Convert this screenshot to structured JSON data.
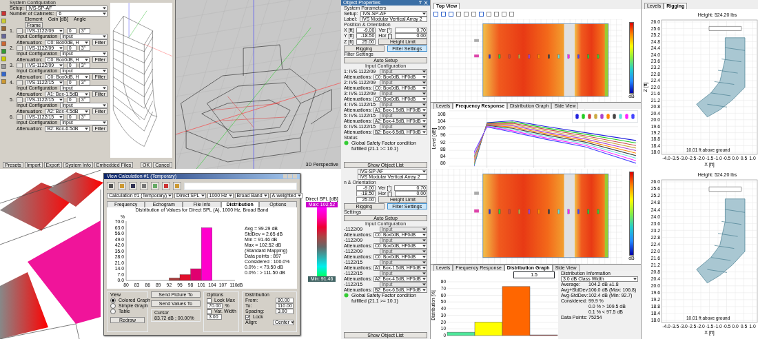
{
  "config_dialog": {
    "title": "System Configuration",
    "setup_label": "Setup:",
    "setup": "IVS-SP-AF",
    "cabinets_label": "Number of Cabinets:",
    "cabinets": "6",
    "headers": [
      "Element",
      "Gain [dB]",
      "Angle"
    ],
    "frame": "Frame",
    "elements": [
      {
        "num": "1.",
        "model": "IVS-1122/09",
        "gain": "0",
        "angle": "3°",
        "input_label": "Input Configuration",
        "input": "Input",
        "atten_label": "Attenuation:",
        "atten": "C0: Box0dB, H",
        "filter": "Filter"
      },
      {
        "num": "2.",
        "model": "IVS-1122/09",
        "gain": "0",
        "angle": "3°",
        "input_label": "Input Configuration",
        "input": "Input",
        "atten_label": "Attenuation:",
        "atten": "C0: Box0dB, H",
        "filter": "Filter"
      },
      {
        "num": "3.",
        "model": "IVS-1122/09",
        "gain": "0",
        "angle": "3°",
        "input_label": "Input Configuration",
        "input": "Input",
        "atten_label": "Attenuation:",
        "atten": "C0: Box0dB, H",
        "filter": "Filter"
      },
      {
        "num": "4.",
        "model": "IVS-1122/15",
        "gain": "0",
        "angle": "3°",
        "input_label": "Input Configuration",
        "input": "Input",
        "atten_label": "Attenuation:",
        "atten": "A1: Box-1.5dB",
        "filter": "Filter"
      },
      {
        "num": "5.",
        "model": "IVS-1122/15",
        "gain": "0",
        "angle": "3°",
        "input_label": "Input Configuration",
        "input": "Input",
        "atten_label": "Attenuation:",
        "atten": "A2: Box-4.5dB",
        "filter": "Filter"
      },
      {
        "num": "6.",
        "model": "IVS-1122/15",
        "gain": "0",
        "angle": "3°",
        "input_label": "Input Configuration",
        "input": "Input",
        "atten_label": "Attenuation:",
        "atten": "B2: Box-6.5dB",
        "filter": "Filter"
      }
    ],
    "buttons": [
      "Presets",
      "Import",
      "Export",
      "System Info",
      "Embedded Files"
    ],
    "dialog_buttons": [
      "OK",
      "Cancel"
    ]
  },
  "view_3d": {
    "label": "3D Perspective"
  },
  "props_top": {
    "title": "Object Properties",
    "section1": "System Parameters",
    "setup_label": "Setup:",
    "setup": "IVS-SP-AF",
    "label_label": "Label:",
    "label": "IVS Modular Vertical Array 2",
    "section2": "Position & Orientation",
    "coords": [
      {
        "label": "X [ft]",
        "value": "-9.00",
        "angle_label": "Ver [°]",
        "angle": "0.70"
      },
      {
        "label": "Y [ft]",
        "value": "-18.50",
        "angle_label": "Hor [°]",
        "angle": "0.00"
      },
      {
        "label": "Z [ft]",
        "value": "25.00"
      }
    ],
    "height_limit": "Height Limit",
    "tabs": [
      {
        "label": "Rigging",
        "selected": false
      },
      {
        "label": "Filter Settings",
        "selected": true
      }
    ],
    "section3": "Filter Settings",
    "auto_setup": "Auto Setup",
    "input_config": "Input Configuration",
    "filters": [
      {
        "label": "1: IVS-1122/09",
        "input": "Input",
        "atten_label": "Attenuations:",
        "atten": "C0: Box0dB, HF0dB"
      },
      {
        "label": "2: IVS-1122/09",
        "input": "Input",
        "atten_label": "Attenuations:",
        "atten": "C0: Box0dB, HF0dB"
      },
      {
        "label": "3: IVS-1122/09",
        "input": "Input",
        "atten_label": "Attenuations:",
        "atten": "C0: Box0dB, HF0dB"
      },
      {
        "label": "4: IVS-1122/15",
        "input": "Input",
        "atten_label": "Attenuations:",
        "atten": "A1: Box-1.5dB, HF0dB"
      },
      {
        "label": "5: IVS-1122/15",
        "input": "Input",
        "atten_label": "Attenuations:",
        "atten": "A2: Box-4.5dB, HF0dB"
      },
      {
        "label": "6: IVS-1122/15",
        "input": "Input",
        "atten_label": "Attenuations:",
        "atten": "B2: Box-6.5dB, HF0dB"
      }
    ],
    "status_label": "Status",
    "status": "Global Safety Factor condition fulfilled (21.1 >= 10.1)",
    "show_list": "Show Object List"
  },
  "props_bottom": {
    "setup": "IVS-SP-AF",
    "label": "IVS Modular Vertical Array 2",
    "section2": "n & Orientation",
    "coords": [
      {
        "value": "-9.00",
        "angle_label": "Ver [°]",
        "angle": "0.70"
      },
      {
        "value": "-18.50",
        "angle_label": "Hor [°]",
        "angle": "0.00"
      },
      {
        "value": "25.00"
      }
    ],
    "height_limit": "Height Limit",
    "tabs": [
      {
        "label": "Rigging",
        "selected": false
      },
      {
        "label": "Filter Settings",
        "selected": true
      }
    ],
    "section3": "Settings",
    "auto_setup": "Auto Setup",
    "input_config": "Input Configuration",
    "filters": [
      {
        "label": "-1122/09",
        "input": "Input",
        "atten_label": "Attenuations:",
        "atten": "C0: Box0dB, HF0dB"
      },
      {
        "label": "-1122/09",
        "input": "Input",
        "atten_label": "Attenuations:",
        "atten": "C0: Box0dB, HF0dB"
      },
      {
        "label": "-1122/09",
        "input": "Input",
        "atten_label": "Attenuations:",
        "atten": "C0: Box0dB, HF0dB"
      },
      {
        "label": "-1122/15",
        "input": "Input",
        "atten_label": "Attenuations:",
        "atten": "A1: Box-1.5dB, HF0dB"
      },
      {
        "label": "-1122/15",
        "input": "Input",
        "atten_label": "Attenuations:",
        "atten": "A2: Box-4.5dB, HF0dB"
      },
      {
        "label": "-1122/15",
        "input": "Input",
        "atten_label": "Attenuations:",
        "atten": "B2: Box-6.5dB, HF0dB"
      }
    ],
    "status": "Global Safety Factor condition fulfilled (21.1 >= 10.1)",
    "show_list": "Show Object List"
  },
  "top_view": {
    "tab": "Top View",
    "unit": "dB"
  },
  "rigging": {
    "tabs": [
      {
        "label": "Levels",
        "selected": false
      },
      {
        "label": "Rigging",
        "selected": true
      }
    ],
    "title": "Height: 524.20 lbs",
    "yticks": [
      "26.0",
      "25.6",
      "25.2",
      "24.8",
      "24.4",
      "24.0",
      "23.6",
      "23.2",
      "22.8",
      "22.4",
      "22.0",
      "21.6",
      "21.2",
      "20.8",
      "20.4",
      "20.0",
      "19.6",
      "19.2",
      "18.8",
      "18.4",
      "18.0"
    ],
    "xticks": [
      "-4.0",
      "-3.5",
      "-3.0",
      "-2.5",
      "-2.0",
      "-1.5",
      "-1.0",
      "-0.5",
      "0.0",
      "0.5",
      "1.0"
    ],
    "xlabel": "X [ft]",
    "ylabel": "Z [ft]",
    "note": "10.01 ft above ground"
  },
  "freq_response": {
    "tabs": [
      {
        "label": "Levels",
        "selected": false
      },
      {
        "label": "Frequency Response",
        "selected": true
      },
      {
        "label": "Distribution Graph",
        "selected": false
      },
      {
        "label": "Side View",
        "selected": false
      }
    ],
    "ylabel": "Level [dB]",
    "yticks": [
      "108",
      "104",
      "100",
      "96",
      "92",
      "88",
      "84",
      "80"
    ],
    "legend": [
      {
        "color": "#2222dd"
      },
      {
        "color": "#22cc22"
      },
      {
        "color": "#cc4444"
      },
      {
        "color": "#ccaa44"
      },
      {
        "color": "#aa44cc"
      },
      {
        "color": "#ff8800"
      },
      {
        "color": "#444444"
      },
      {
        "color": "#66dddd"
      },
      {
        "color": "#ff22ff"
      },
      {
        "color": "#4444ff"
      }
    ]
  },
  "calc_dialog": {
    "title": "View Calculation #1 (Temporary)",
    "combos": [
      "Calculation #1 (Temporary)",
      "Direct SPL",
      "1000 Hz",
      "Broad Band",
      "A-weighted"
    ],
    "tabs": [
      {
        "label": "Frequency",
        "selected": false
      },
      {
        "label": "Echogram",
        "selected": false
      },
      {
        "label": "File Info",
        "selected": false
      },
      {
        "label": "Distribution",
        "selected": true
      },
      {
        "label": "Options",
        "selected": false
      }
    ],
    "chart_data": {
      "type": "bar",
      "title": "Distribution of Values for Direct SPL (A), 1000 Hz, Broad Band",
      "xlabel": "dB",
      "ylabel": "%",
      "x": [
        93.5,
        96.5,
        99.5,
        102.5
      ],
      "values": [
        3,
        7,
        14,
        63
      ],
      "colors": [
        "#a83c3c",
        "#e0102c",
        "#e00070",
        "#ff00cc"
      ],
      "xlim": [
        80,
        110
      ],
      "ylim": [
        0,
        70
      ],
      "xticks": [
        80,
        83,
        86,
        89,
        92,
        95,
        98,
        101,
        104,
        107,
        110
      ],
      "yticks": [
        {
          "value": 0,
          "label": "0.0"
        },
        {
          "value": 7,
          "label": "7.0"
        },
        {
          "value": 14,
          "label": "14.0"
        },
        {
          "value": 21,
          "label": "21.0"
        },
        {
          "value": 28,
          "label": "28.0"
        },
        {
          "value": 35,
          "label": "35.0"
        },
        {
          "value": 42,
          "label": "42.0"
        },
        {
          "value": 49,
          "label": "49.0"
        },
        {
          "value": 56,
          "label": "56.0"
        },
        {
          "value": 63,
          "label": "63.0"
        },
        {
          "value": 70,
          "label": "70.0"
        }
      ]
    },
    "stats": [
      "Avg = 99.29 dB",
      "StdDev = 2.65 dB",
      "Min = 91.46 dB",
      "Max = 102.52 dB",
      "(Standard Mapping)",
      "Data points : 897",
      "Considered : 100.0%",
      "0.0% : < 79.50 dB",
      "0.0% : > 111.50 dB"
    ],
    "view_label": "View",
    "view_options": [
      {
        "label": "Colored Graph",
        "selected": true
      },
      {
        "label": "Simple Graph",
        "selected": false
      },
      {
        "label": "Table",
        "selected": false
      }
    ],
    "redraw": "Redraw",
    "send_buttons": [
      "Send Picture To",
      "Send Values To"
    ],
    "cursor_label": "Cursor",
    "cursor": "83.72 dB ; 00.00%",
    "options_label": "Options",
    "lock_max": {
      "label": "Lock Max",
      "checked": false,
      "value": "70.00",
      "unit": "%"
    },
    "var_width": {
      "label": "Var. Width",
      "checked": false,
      "value": "3.00"
    },
    "dist_label": "Distribution",
    "from_label": "From:",
    "from": "80.00",
    "to_label": "To:",
    "to": "110.00",
    "spacing_label": "Spacing:",
    "spacing": "3.00",
    "lock": {
      "label": "Lock",
      "checked": true
    },
    "align_label": "Align:",
    "align": "Center"
  },
  "spl_legend": {
    "title": "Direct SPL [dB]",
    "max": "Max: 102.52",
    "min": "Min: 91.46"
  },
  "top_view_2": {
    "unit": "dB"
  },
  "rigging_2": {
    "title": "Height: 524.20 lbs",
    "yticks": [
      "26.0",
      "25.6",
      "25.2",
      "24.8",
      "24.4",
      "24.0",
      "23.6",
      "23.2",
      "22.8",
      "22.4",
      "22.0",
      "21.6",
      "21.2",
      "20.8",
      "20.4",
      "20.0",
      "19.6",
      "19.2",
      "18.8",
      "18.4",
      "18.0"
    ],
    "xticks": [
      "-4.0",
      "-3.5",
      "-3.0",
      "-2.5",
      "-2.0",
      "-1.5",
      "-1.0",
      "-0.5",
      "0.0",
      "0.5",
      "1.0"
    ],
    "xlabel": "X [ft]",
    "note": "10.01 ft above ground"
  },
  "distribution": {
    "tabs": [
      {
        "label": "Levels",
        "selected": false
      },
      {
        "label": "Frequency Response",
        "selected": false
      },
      {
        "label": "Distribution Graph",
        "selected": true
      },
      {
        "label": "Side View",
        "selected": false
      }
    ],
    "scale_label": "1.5",
    "chart_data": {
      "type": "bar",
      "ylabel": "Distribution [%]",
      "values": [
        5,
        20,
        73,
        1
      ],
      "colors": [
        "#4de89a",
        "#ffff00",
        "#ff6600",
        "#b03030"
      ],
      "ylim": [
        0,
        80
      ],
      "yticks": [
        0,
        10,
        20,
        30,
        40,
        50,
        60,
        70,
        80
      ],
      "grid": true
    },
    "info_title": "Distribution Information",
    "class_width": "3.0 dB Class Width",
    "info": [
      {
        "label": "Average:",
        "value": "104.2 dB ±1.8"
      },
      {
        "label": "Avg+StdDev:",
        "value": "106.0 dB (Max: 106.8)"
      },
      {
        "label": "Avg-StdDev:",
        "value": "102.4 dB (Min: 92.7)"
      },
      {
        "label": "Considered:",
        "value": "99.9 %"
      },
      {
        "value": "0.0 % > 109.5 dB"
      },
      {
        "value": "0.1 % < 97.5 dB"
      },
      {
        "label": "Data Points:",
        "value": "75254"
      }
    ]
  }
}
